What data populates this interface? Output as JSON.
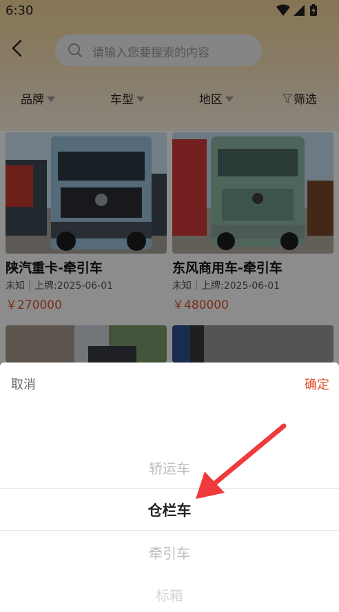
{
  "status_bar": {
    "time": "6:30"
  },
  "search": {
    "placeholder": "请输入您要搜索的内容"
  },
  "filters": [
    {
      "label": "品牌"
    },
    {
      "label": "车型"
    },
    {
      "label": "地区"
    },
    {
      "label": "筛选"
    }
  ],
  "listings": [
    {
      "title": "陕汽重卡-牵引车",
      "info": "未知｜上牌:2025-06-01",
      "price": "￥270000"
    },
    {
      "title": "东风商用车-牵引车",
      "info": "未知｜上牌:2025-06-01",
      "price": "￥480000"
    }
  ],
  "picker": {
    "cancel_label": "取消",
    "confirm_label": "确定",
    "options": [
      "轿运车",
      "仓栏车",
      "牵引车",
      "标箱"
    ],
    "selected_index": 1
  },
  "colors": {
    "accent": "#e0542b",
    "header_bg": "#f6d79a",
    "arrow": "#ef3b3b"
  }
}
